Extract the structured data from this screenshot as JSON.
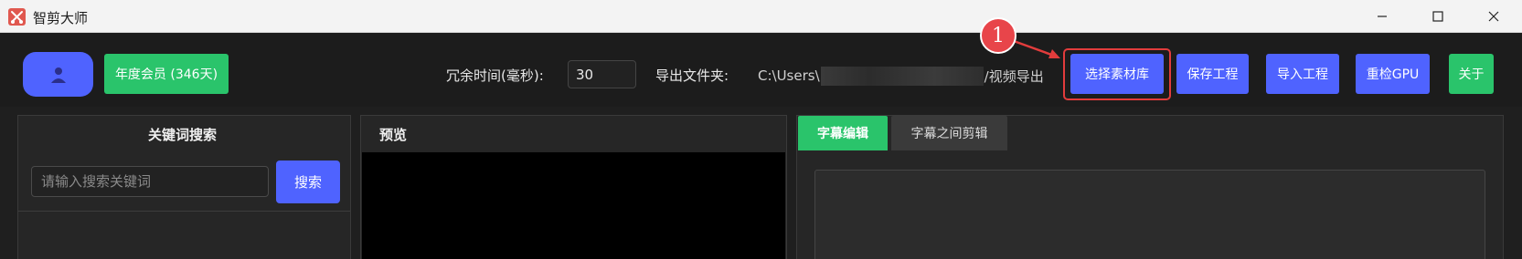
{
  "window": {
    "title": "智剪大师",
    "icon": "scissors-app-icon"
  },
  "toolbar": {
    "avatar_icon": "user-icon",
    "member_badge": "年度会员 (346天)",
    "redundant_time_label": "冗余时间(毫秒):",
    "redundant_time_value": "30",
    "export_folder_label": "导出文件夹:",
    "export_path_prefix": "C:\\Users\\",
    "export_path_suffix": "/视频导出",
    "buttons": {
      "select_material": "选择素材库",
      "save_project": "保存工程",
      "import_project": "导入工程",
      "recheck_gpu": "重检GPU",
      "about": "关于"
    }
  },
  "annotation": {
    "marker_number": "1",
    "color": "#e23c3c"
  },
  "keyword_panel": {
    "title": "关键词搜索",
    "search_placeholder": "请输入搜索关键词",
    "search_button": "搜索"
  },
  "preview_panel": {
    "title": "预览"
  },
  "subtitle_panel": {
    "tabs": [
      {
        "label": "字幕编辑",
        "active": true
      },
      {
        "label": "字幕之间剪辑",
        "active": false
      }
    ]
  },
  "colors": {
    "primary_button": "#4f63ff",
    "green_accent": "#2ac46b",
    "background": "#1f1f1f"
  }
}
